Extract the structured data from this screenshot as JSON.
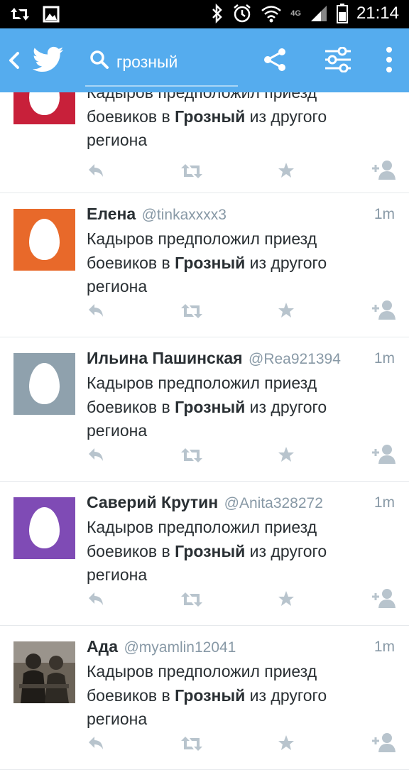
{
  "status_bar": {
    "time": "21:14",
    "network": "4G",
    "icons": [
      "retweet-notification-icon",
      "image-notification-icon",
      "bluetooth-icon",
      "alarm-icon",
      "wifi-icon",
      "signal-icon",
      "battery-icon"
    ]
  },
  "app_bar": {
    "color": "#55acee",
    "search_value": "грозный",
    "icons": [
      "back-icon",
      "twitter-bird-icon",
      "search-icon",
      "share-icon",
      "filter-icon",
      "overflow-menu-icon"
    ]
  },
  "tweets": [
    {
      "name": "",
      "handle": "",
      "time": "",
      "text_before": "Кадыров предположил приезд боевиков в ",
      "text_bold": "Грозный",
      "text_after": " из другого региона",
      "avatar_color": "#c8203a"
    },
    {
      "name": "Елена",
      "handle": "@tinkaxxxx3",
      "time": "1m",
      "text_before": "Кадыров предположил приезд боевиков в ",
      "text_bold": "Грозный",
      "text_after": " из другого региона",
      "avatar_color": "#e8692a"
    },
    {
      "name": "Ильина Пашинская",
      "handle": "@Rea921394",
      "time": "1m",
      "text_before": "Кадыров предположил приезд боевиков в ",
      "text_bold": "Грозный",
      "text_after": " из другого региона",
      "avatar_color": "#8fa1ad"
    },
    {
      "name": "Саверий Крутин",
      "handle": "@Anita328272",
      "time": "1m",
      "text_before": "Кадыров предположил приезд боевиков в ",
      "text_bold": "Грозный",
      "text_after": " из другого региона",
      "avatar_color": "#7f4bb5"
    },
    {
      "name": "Ада",
      "handle": "@myamlin12041",
      "time": "1m",
      "text_before": "Кадыров предположил приезд боевиков в ",
      "text_bold": "Грозный",
      "text_after": " из другого региона",
      "avatar_color": "#6b6358"
    }
  ],
  "action_icons": [
    "reply-icon",
    "retweet-icon",
    "favorite-icon",
    "follow-icon"
  ],
  "action_color": "#b8c4cd"
}
